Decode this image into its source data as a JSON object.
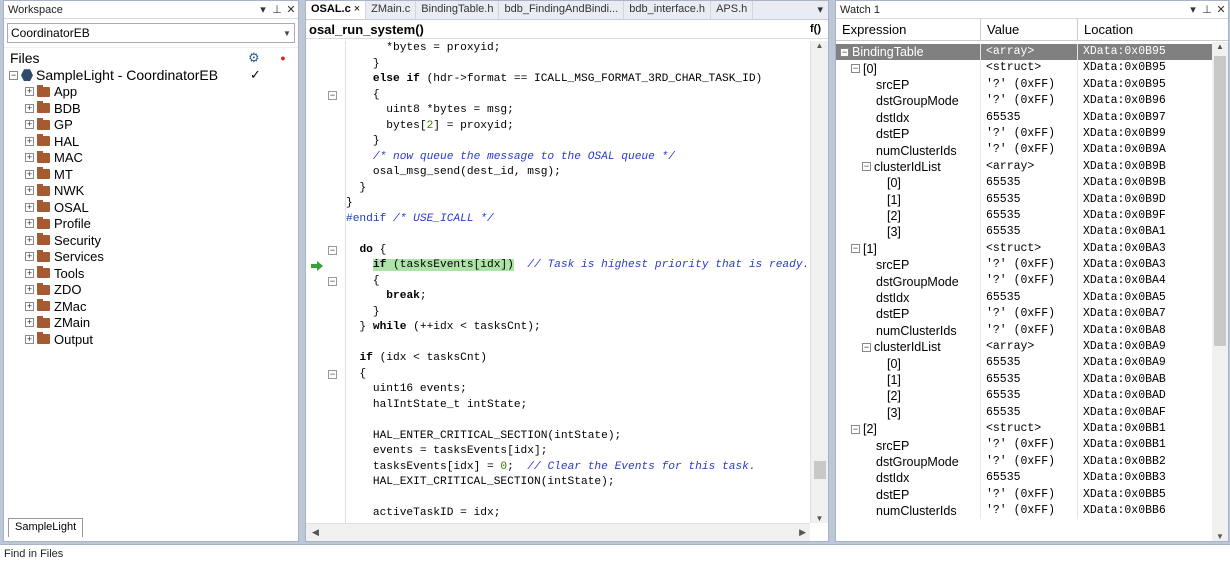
{
  "workspace": {
    "title": "Workspace",
    "config": "CoordinatorEB",
    "files_label": "Files",
    "project": "SampleLight - CoordinatorEB",
    "project_check": "✓",
    "folders": [
      "App",
      "BDB",
      "GP",
      "HAL",
      "MAC",
      "MT",
      "NWK",
      "OSAL",
      "Profile",
      "Security",
      "Services",
      "Tools",
      "ZDO",
      "ZMac",
      "ZMain",
      "Output"
    ],
    "bottom_tab": "SampleLight"
  },
  "editor": {
    "tabs": [
      "OSAL.c",
      "ZMain.c",
      "BindingTable.h",
      "bdb_FindingAndBindi...",
      "bdb_interface.h",
      "APS.h"
    ],
    "function": "osal_run_system()",
    "func_icon": "f()",
    "lines": [
      "      *bytes = proxyid;",
      "    }",
      "    else if (hdr->format == ICALL_MSG_FORMAT_3RD_CHAR_TASK_ID)",
      "    {",
      "      uint8 *bytes = msg;",
      "      bytes[2] = proxyid;",
      "    }",
      "    /* now queue the message to the OSAL queue */",
      "    osal_msg_send(dest_id, msg);",
      "  }",
      "}",
      "#endif /* USE_ICALL */",
      "",
      "  do {",
      "    if (tasksEvents[idx])  // Task is highest priority that is ready.",
      "    {",
      "      break;",
      "    }",
      "  } while (++idx < tasksCnt);",
      "",
      "  if (idx < tasksCnt)",
      "  {",
      "    uint16 events;",
      "    halIntState_t intState;",
      "",
      "    HAL_ENTER_CRITICAL_SECTION(intState);",
      "    events = tasksEvents[idx];",
      "    tasksEvents[idx] = 0;  // Clear the Events for this task.",
      "    HAL_EXIT_CRITICAL_SECTION(intState);",
      "",
      "    activeTaskID = idx;"
    ]
  },
  "watch": {
    "title": "Watch 1",
    "headers": [
      "Expression",
      "Value",
      "Location"
    ],
    "rows": [
      {
        "d": 0,
        "pm": "⊟",
        "e": "BindingTable",
        "v": "<array>",
        "l": "XData:0x0B95",
        "sel": true
      },
      {
        "d": 1,
        "pm": "⊟",
        "e": "[0]",
        "v": "<struct>",
        "l": "XData:0x0B95"
      },
      {
        "d": 2,
        "e": "srcEP",
        "v": "'?' (0xFF)",
        "l": "XData:0x0B95"
      },
      {
        "d": 2,
        "e": "dstGroupMode",
        "v": "'?' (0xFF)",
        "l": "XData:0x0B96"
      },
      {
        "d": 2,
        "e": "dstIdx",
        "v": "65535",
        "l": "XData:0x0B97"
      },
      {
        "d": 2,
        "e": "dstEP",
        "v": "'?' (0xFF)",
        "l": "XData:0x0B99"
      },
      {
        "d": 2,
        "e": "numClusterIds",
        "v": "'?' (0xFF)",
        "l": "XData:0x0B9A"
      },
      {
        "d": 2,
        "pm": "⊟",
        "e": "clusterIdList",
        "v": "<array>",
        "l": "XData:0x0B9B"
      },
      {
        "d": 3,
        "e": "[0]",
        "v": "65535",
        "l": "XData:0x0B9B"
      },
      {
        "d": 3,
        "e": "[1]",
        "v": "65535",
        "l": "XData:0x0B9D"
      },
      {
        "d": 3,
        "e": "[2]",
        "v": "65535",
        "l": "XData:0x0B9F"
      },
      {
        "d": 3,
        "e": "[3]",
        "v": "65535",
        "l": "XData:0x0BA1"
      },
      {
        "d": 1,
        "pm": "⊟",
        "e": "[1]",
        "v": "<struct>",
        "l": "XData:0x0BA3"
      },
      {
        "d": 2,
        "e": "srcEP",
        "v": "'?' (0xFF)",
        "l": "XData:0x0BA3"
      },
      {
        "d": 2,
        "e": "dstGroupMode",
        "v": "'?' (0xFF)",
        "l": "XData:0x0BA4"
      },
      {
        "d": 2,
        "e": "dstIdx",
        "v": "65535",
        "l": "XData:0x0BA5"
      },
      {
        "d": 2,
        "e": "dstEP",
        "v": "'?' (0xFF)",
        "l": "XData:0x0BA7"
      },
      {
        "d": 2,
        "e": "numClusterIds",
        "v": "'?' (0xFF)",
        "l": "XData:0x0BA8"
      },
      {
        "d": 2,
        "pm": "⊟",
        "e": "clusterIdList",
        "v": "<array>",
        "l": "XData:0x0BA9"
      },
      {
        "d": 3,
        "e": "[0]",
        "v": "65535",
        "l": "XData:0x0BA9"
      },
      {
        "d": 3,
        "e": "[1]",
        "v": "65535",
        "l": "XData:0x0BAB"
      },
      {
        "d": 3,
        "e": "[2]",
        "v": "65535",
        "l": "XData:0x0BAD"
      },
      {
        "d": 3,
        "e": "[3]",
        "v": "65535",
        "l": "XData:0x0BAF"
      },
      {
        "d": 1,
        "pm": "⊟",
        "e": "[2]",
        "v": "<struct>",
        "l": "XData:0x0BB1"
      },
      {
        "d": 2,
        "e": "srcEP",
        "v": "'?' (0xFF)",
        "l": "XData:0x0BB1"
      },
      {
        "d": 2,
        "e": "dstGroupMode",
        "v": "'?' (0xFF)",
        "l": "XData:0x0BB2"
      },
      {
        "d": 2,
        "e": "dstIdx",
        "v": "65535",
        "l": "XData:0x0BB3"
      },
      {
        "d": 2,
        "e": "dstEP",
        "v": "'?' (0xFF)",
        "l": "XData:0x0BB5"
      },
      {
        "d": 2,
        "e": "numClusterIds",
        "v": "'?' (0xFF)",
        "l": "XData:0x0BB6"
      }
    ]
  },
  "bottom": {
    "title": "Find in Files"
  }
}
